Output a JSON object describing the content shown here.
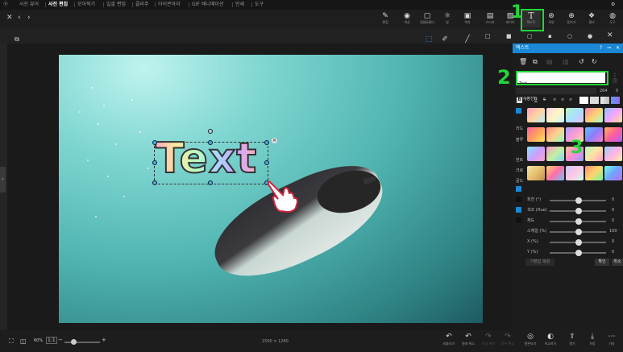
{
  "menu": {
    "items": [
      "사진 뷰어",
      "사진 편집",
      "모아찍기",
      "일괄 편집",
      "콜라주",
      "아이콘아이",
      "GIF 애니메이션",
      "인쇄",
      "도구"
    ],
    "active_index": 1
  },
  "toolbar": {
    "buttons": [
      "편집",
      "색상",
      "필름&필터",
      "빛",
      "액자",
      "스티커",
      "레이어",
      "텍스트",
      "모양",
      "돋보기",
      "필터",
      "도구"
    ]
  },
  "left_side": {
    "copy_label": "레이어"
  },
  "text_options": {
    "select_label": "선택",
    "edit_label": "펜&붓",
    "brush_label": "붓"
  },
  "panel": {
    "title": "텍스트",
    "text_value": "Text",
    "font_name": "HY수평선B",
    "font_size": "264",
    "font_extra": "0",
    "side_labels": [
      "라드",
      "블루",
      "번트",
      "크로",
      "골드"
    ],
    "sliders": [
      {
        "label": "회전 (°)",
        "value": "0"
      },
      {
        "label": "색조 (Hue)",
        "value": "0"
      },
      {
        "label": "채도",
        "value": "0"
      },
      {
        "label": "스케일 (%)",
        "value": "100"
      },
      {
        "label": "X (%)",
        "value": "0"
      },
      {
        "label": "Y (%)",
        "value": "0"
      }
    ],
    "apply_label": "확인",
    "cancel_label": "취소",
    "reset_label": "기본값 복원"
  },
  "canvas": {
    "overlay_text": "Text",
    "image_size": "1500 × 1280"
  },
  "callouts": [
    "1",
    "2",
    "3"
  ],
  "bottom": {
    "zoom": "60%",
    "buttons": [
      "되돌리기",
      "원래 취소",
      "다시 하기",
      "모두 취소",
      "원본보기",
      "비교하기",
      "열기",
      "저장",
      "기타"
    ]
  },
  "colors": {
    "accent": "#1a88d6",
    "callout": "#22d63a"
  }
}
